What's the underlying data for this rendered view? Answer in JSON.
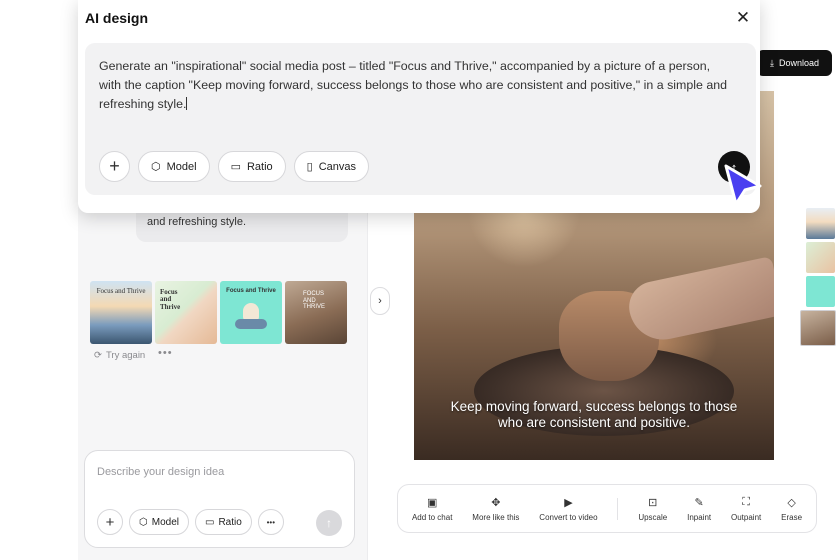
{
  "modal": {
    "title": "AI design",
    "prompt": "Generate an \"inspirational\" social media post – titled \"Focus and Thrive,\" accompanied by a picture of a person, with the caption \"Keep moving forward, success belongs to those who are consistent and positive,\" in a simple and refreshing style.",
    "buttons": {
      "model": "Model",
      "ratio": "Ratio",
      "canvas": "Canvas"
    }
  },
  "chat": {
    "prompt_bubble_tail": "and refreshing style.",
    "thumbnails": [
      {
        "text": "Focus and Thrive"
      },
      {
        "text": "Focus and Thrive"
      },
      {
        "text": "Focus and Thrive"
      },
      {
        "text": "FOCUS AND THRIVE"
      }
    ],
    "try_again": "Try again",
    "more": "•••",
    "input": {
      "placeholder": "Describe your design idea",
      "model": "Model",
      "ratio": "Ratio",
      "more": "•••"
    }
  },
  "canvas": {
    "download": "Download",
    "caption": "Keep moving forward, success belongs to those who are consistent and positive."
  },
  "toolbar": {
    "items": [
      {
        "label": "Add to chat",
        "icon": "image-plus-icon"
      },
      {
        "label": "More like this",
        "icon": "sparkle-grid-icon"
      },
      {
        "label": "Convert to video",
        "icon": "video-icon"
      },
      {
        "label": "Upscale",
        "icon": "hd-icon"
      },
      {
        "label": "Inpaint",
        "icon": "brush-icon"
      },
      {
        "label": "Outpaint",
        "icon": "expand-icon"
      },
      {
        "label": "Erase",
        "icon": "eraser-icon"
      }
    ]
  },
  "colors": {
    "accent": "#4a3ff0",
    "dark": "#111111",
    "panel_bg": "#f6f6f7"
  }
}
